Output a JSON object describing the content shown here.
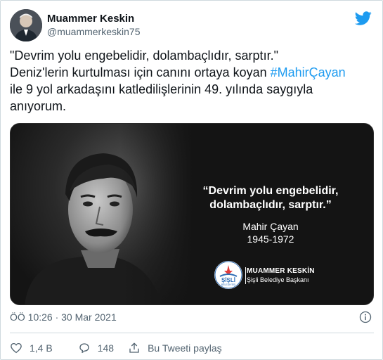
{
  "user": {
    "name": "Muammer Keskin",
    "handle": "@muammerkeskin75"
  },
  "tweet": {
    "line1": "\"Devrim yolu engebelidir, dolambaçlıdır, sarptır.\"",
    "line2_prefix": "Deniz'lerin kurtulması için canını ortaya koyan ",
    "hashtag": "#MahirÇayan",
    "line3": "ile 9 yol arkadaşını katledilişlerinin 49. yılında saygıyla",
    "line4": "anıyorum."
  },
  "media": {
    "quote_line1": "“Devrim yolu engebelidir,",
    "quote_line2": "dolambaçlıdır, sarptır.”",
    "person_name": "Mahir Çayan",
    "person_years": "1945-1972",
    "logo_text": "ŞİŞLİ",
    "logo_subtext": "BELEDİYESİ",
    "signature_name": "MUAMMER KESKİN",
    "signature_title": "Şişli Belediye Başkanı"
  },
  "meta": {
    "timestamp": "ÖÖ 10:26 · 30 Mar 2021"
  },
  "actions": {
    "likes": "1,4 B",
    "replies": "148",
    "share_label": "Bu Tweeti paylaş"
  },
  "colors": {
    "twitter_blue": "#1d9bf0",
    "like_red": "#f91880",
    "text_secondary": "#536471"
  },
  "icons": [
    "twitter-bird-icon",
    "info-icon",
    "heart-icon",
    "reply-icon",
    "share-icon"
  ]
}
